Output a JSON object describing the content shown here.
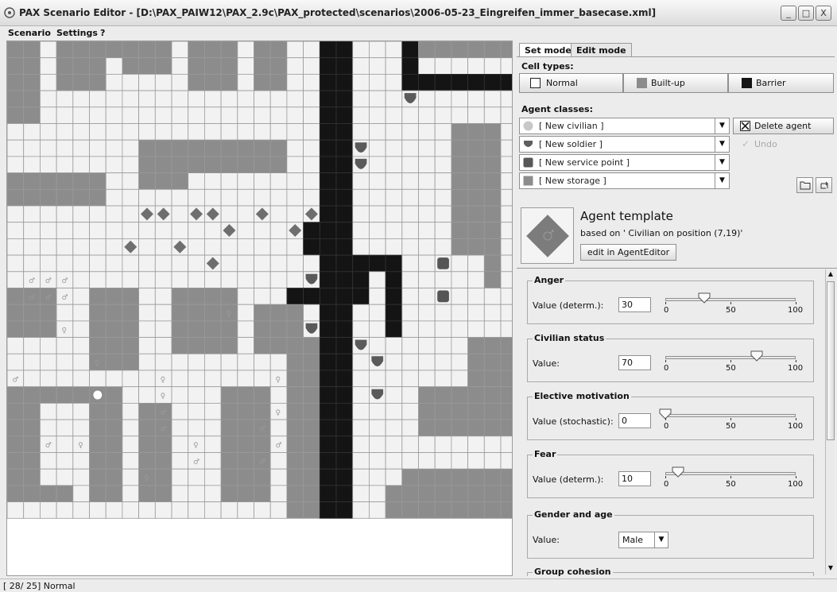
{
  "window": {
    "title": "PAX Scenario Editor - [D:\\PAX_PAIW12\\PAX_2.9c\\PAX_protected\\scenarios\\2006-05-23_Eingreifen_immer_basecase.xml]",
    "minimize": "_",
    "maximize": "□",
    "close": "X"
  },
  "menu": {
    "scenario": "Scenario",
    "settings": "Settings",
    "help": "?"
  },
  "tabs": {
    "set_mode": "Set mode",
    "edit_mode": "Edit mode"
  },
  "cell_types": {
    "heading": "Cell types:",
    "normal": "Normal",
    "built_up": "Built-up",
    "barrier": "Barrier"
  },
  "agent_classes": {
    "heading": "Agent classes:",
    "civilian": "[ New civilian ]",
    "soldier": "[ New soldier ]",
    "service_point": "[ New service point ]",
    "storage": "[ New storage ]",
    "delete_agent": "Delete agent",
    "undo": "Undo"
  },
  "template": {
    "title": "Agent template",
    "subtitle": "based on ' Civilian on position (7,19)'",
    "edit_button": "edit in AgentEditor"
  },
  "properties": [
    {
      "name": "Anger",
      "label": "Value (determ.):",
      "value": "30",
      "slider": 30
    },
    {
      "name": "Civilian status",
      "label": "Value:",
      "value": "70",
      "slider": 70
    },
    {
      "name": "Elective motivation",
      "label": "Value (stochastic):",
      "value": "0",
      "slider": 0
    },
    {
      "name": "Fear",
      "label": "Value (determ.):",
      "value": "10",
      "slider": 10
    }
  ],
  "slider_scale": {
    "min": "0",
    "mid": "50",
    "max": "100"
  },
  "gender": {
    "name": "Gender and age",
    "label": "Value:",
    "value": "Male"
  },
  "group_cohesion": {
    "name": "Group cohesion"
  },
  "status": {
    "text": "[ 28/ 25]  Normal"
  },
  "colors": {
    "built_up": "#8c8c8c",
    "barrier": "#141414",
    "normal": "#f2f2f2",
    "grid": "#9a9a9a"
  }
}
